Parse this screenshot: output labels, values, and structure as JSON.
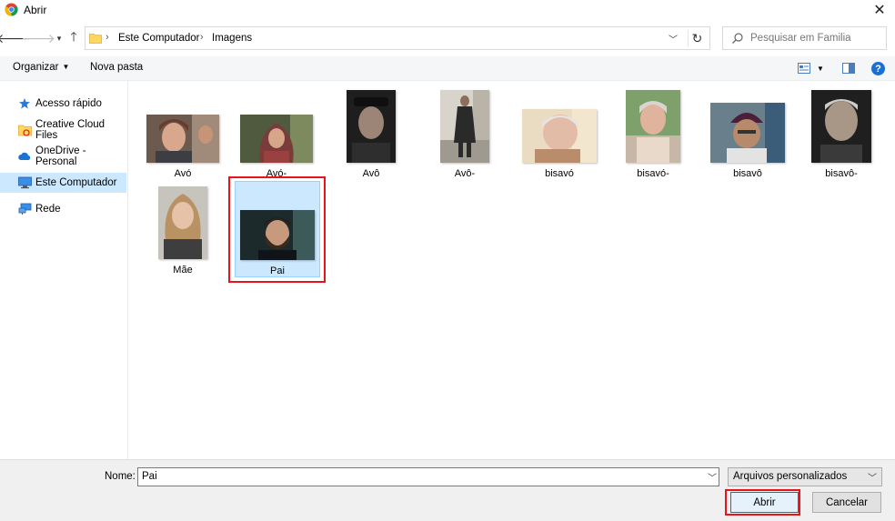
{
  "window": {
    "title": "Abrir",
    "close_glyph": "✕"
  },
  "nav": {
    "breadcrumb": [
      "Este Computador",
      "Imagens"
    ],
    "separator": "›",
    "search_placeholder": "Pesquisar em Familia"
  },
  "toolbar": {
    "organize_label": "Organizar",
    "new_folder_label": "Nova pasta",
    "help_glyph": "?"
  },
  "sidebar": {
    "items": [
      {
        "label": "Acesso rápido",
        "icon": "star-pin-icon"
      },
      {
        "label": "Creative Cloud Files",
        "icon": "creative-cloud-folder-icon"
      },
      {
        "label": "OneDrive - Personal",
        "icon": "cloud-icon"
      },
      {
        "label": "Este Computador",
        "icon": "computer-icon",
        "selected": true
      },
      {
        "label": "Rede",
        "icon": "network-icon"
      }
    ]
  },
  "files": [
    {
      "label": "Avó"
    },
    {
      "label": "Avó-"
    },
    {
      "label": "Avô"
    },
    {
      "label": "Avô-"
    },
    {
      "label": "bisavó"
    },
    {
      "label": "bisavó-"
    },
    {
      "label": "bisavô"
    },
    {
      "label": "bisavô-"
    },
    {
      "label": "Mãe"
    },
    {
      "label": "Pai",
      "selected": true
    }
  ],
  "footer": {
    "name_label": "Nome:",
    "name_value": "Pai",
    "filter_value": "Arquivos personalizados",
    "open_label": "Abrir",
    "cancel_label": "Cancelar"
  },
  "colors": {
    "selection": "#cce8ff",
    "highlight": "#e8141c",
    "accent": "#0078d7"
  }
}
